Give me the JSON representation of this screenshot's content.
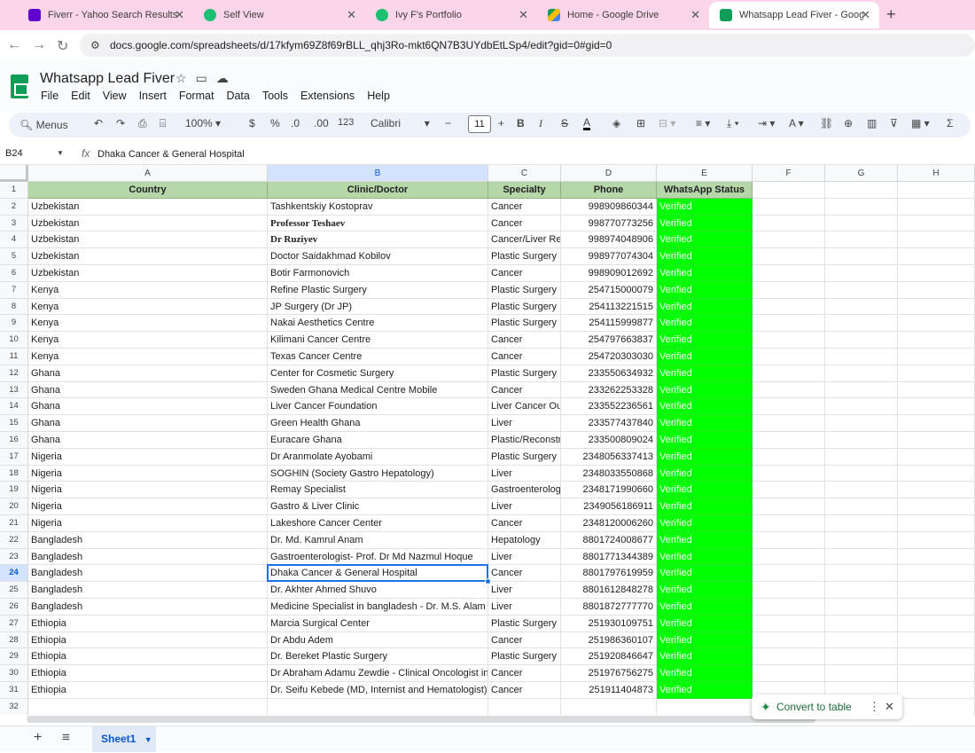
{
  "browser": {
    "tabs": [
      {
        "title": "Fiverr - Yahoo Search Results",
        "icon": "yahoo-icon",
        "color": "#6001d2"
      },
      {
        "title": "Self View",
        "icon": "fiverr-icon",
        "color": "#1dbf73"
      },
      {
        "title": "Ivy F's Portfolio",
        "icon": "fiverr-icon",
        "color": "#1dbf73"
      },
      {
        "title": "Home - Google Drive",
        "icon": "google-drive-icon",
        "color": "#fbbc04"
      },
      {
        "title": "Whatsapp Lead Fiver - Google S",
        "icon": "google-sheets-icon",
        "color": "#0f9d58"
      }
    ],
    "url": "docs.google.com/spreadsheets/d/17kfym69Z8f69rBLL_qhj3Ro-mkt6QN7B3UYdbEtLSp4/edit?gid=0#gid=0"
  },
  "doc": {
    "title": "Whatsapp Lead Fiver",
    "menu": [
      "File",
      "Edit",
      "View",
      "Insert",
      "Format",
      "Data",
      "Tools",
      "Extensions",
      "Help"
    ]
  },
  "toolbar": {
    "menus_label": "Menus",
    "zoom": "100%",
    "currency": "$",
    "percent": "%",
    "dec_decrease": ".0",
    "dec_increase": ".00",
    "number_format": "123",
    "font": "Calibri",
    "font_size": "11"
  },
  "formula_bar": {
    "cell_ref": "B24",
    "value": "Dhaka Cancer & General Hospital"
  },
  "grid": {
    "columns": [
      "A",
      "B",
      "C",
      "D",
      "E",
      "F",
      "G",
      "H"
    ],
    "selected_column": "B",
    "selected_row": 24,
    "header_row": [
      "Country",
      "Clinic/Doctor",
      "Specialty",
      "Phone",
      "WhatsApp Status"
    ],
    "rows": [
      [
        "Uzbekistan",
        "Tashkentskiy Kostoprav",
        "Cancer",
        "998909860344",
        "Verified"
      ],
      [
        "Uzbekistan",
        "Professor Teshaev",
        "Cancer",
        "998770773256",
        "Verified"
      ],
      [
        "Uzbekistan",
        "Dr Ruziyev",
        "Cancer/Liver Ref",
        "998974048906",
        "Verified"
      ],
      [
        "Uzbekistan",
        "Doctor Saidakhmad Kobilov",
        "Plastic Surgery",
        "998977074304",
        "Verified"
      ],
      [
        "Uzbekistan",
        "Botir Farmonovich",
        "Cancer",
        "998909012692",
        "Verified"
      ],
      [
        "Kenya",
        "Refine Plastic Surgery",
        "Plastic Surgery",
        "254715000079",
        "Verified"
      ],
      [
        "Kenya",
        "JP Surgery (Dr JP)",
        "Plastic Surgery",
        "254113221515",
        "Verified"
      ],
      [
        "Kenya",
        "Nakai Aesthetics Centre",
        "Plastic Surgery",
        "254115999877",
        "Verified"
      ],
      [
        "Kenya",
        "Kilimani Cancer Centre",
        "Cancer",
        "254797663837",
        "Verified"
      ],
      [
        "Kenya",
        "Texas Cancer Centre",
        "Cancer",
        "254720303030",
        "Verified"
      ],
      [
        "Ghana",
        "Center for Cosmetic Surgery",
        "Plastic Surgery",
        "233550634932",
        "Verified"
      ],
      [
        "Ghana",
        "Sweden Ghana Medical Centre Mobile",
        "Cancer",
        "233262253328",
        "Verified"
      ],
      [
        "Ghana",
        "Liver Cancer Foundation",
        "Liver Cancer Out",
        "233552236561",
        "Verified"
      ],
      [
        "Ghana",
        "Green Health Ghana",
        "Liver",
        "233577437840",
        "Verified"
      ],
      [
        "Ghana",
        "Euracare Ghana",
        "Plastic/Reconstr",
        "233500809024",
        "Verified"
      ],
      [
        "Nigeria",
        "Dr Aranmolate Ayobami",
        "Plastic Surgery",
        "2348056337413",
        "Verified"
      ],
      [
        "Nigeria",
        "SOGHIN (Society Gastro Hepatology)",
        "Liver",
        "2348033550868",
        "Verified"
      ],
      [
        "Nigeria",
        "Remay Specialist",
        "Gastroenterolog",
        "2348171990660",
        "Verified"
      ],
      [
        "Nigeria",
        "Gastro & Liver Clinic",
        "Liver",
        "2349056186911",
        "Verified"
      ],
      [
        "Nigeria",
        "Lakeshore Cancer Center",
        "Cancer",
        "2348120006260",
        "Verified"
      ],
      [
        "Bangladesh",
        "Dr. Md. Kamrul Anam",
        "Hepatology",
        "8801724008677",
        "Verified"
      ],
      [
        "Bangladesh",
        "Gastroenterologist- Prof. Dr Md Nazmul Hoque",
        "Liver",
        "8801771344389",
        "Verified"
      ],
      [
        "Bangladesh",
        "Dhaka Cancer & General Hospital",
        "Cancer",
        "8801797619959",
        "Verified"
      ],
      [
        "Bangladesh",
        "Dr. Akhter Ahmed Shuvo",
        "Liver",
        "8801612848278",
        "Verified"
      ],
      [
        "Bangladesh",
        "Medicine Specialist in bangladesh - Dr. M.S. Alam (U",
        "Liver",
        "8801872777770",
        "Verified"
      ],
      [
        "Ethiopia",
        "Marcia Surgical Center",
        "Plastic Surgery",
        "251930109751",
        "Verified"
      ],
      [
        "Ethiopia",
        "Dr Abdu Adem",
        "Cancer",
        "251986360107",
        "Verified"
      ],
      [
        "Ethiopia",
        "Dr. Bereket Plastic Surgery",
        "Plastic Surgery",
        "251920846647",
        "Verified"
      ],
      [
        "Ethiopia",
        "Dr Abraham Adamu Zewdie - Clinical Oncologist in",
        "Cancer",
        "251976756275",
        "Verified"
      ],
      [
        "Ethiopia",
        "Dr. Seifu Kebede (MD, Internist and Hematologist) -",
        "Cancer",
        "251911404873",
        "Verified"
      ]
    ],
    "last_row_number": 32,
    "verified_color": "#00ff00",
    "header_color": "#b6d7a8"
  },
  "convert_chip": {
    "label": "Convert to table"
  },
  "sheets": {
    "active": "Sheet1"
  }
}
